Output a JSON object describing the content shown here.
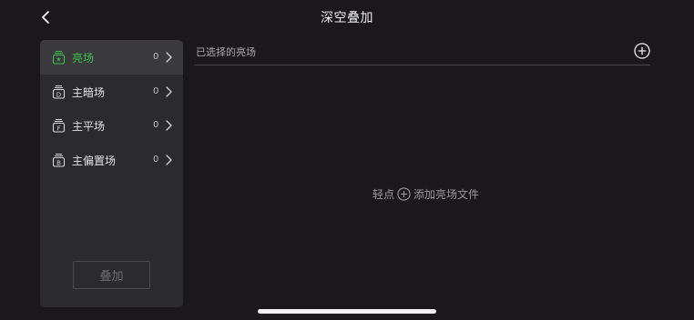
{
  "header": {
    "title": "深空叠加",
    "back_icon": "chevron-left-icon"
  },
  "sidebar": {
    "items": [
      {
        "label": "亮场",
        "count": "0",
        "icon": "light-frame-icon",
        "icon_letter": "",
        "active": true
      },
      {
        "label": "主暗场",
        "count": "0",
        "icon": "dark-frame-icon",
        "icon_letter": "D",
        "active": false
      },
      {
        "label": "主平场",
        "count": "0",
        "icon": "flat-frame-icon",
        "icon_letter": "F",
        "active": false
      },
      {
        "label": "主偏置场",
        "count": "0",
        "icon": "bias-frame-icon",
        "icon_letter": "B",
        "active": false
      }
    ],
    "stack_button": "叠加"
  },
  "main": {
    "selected_label": "已选择的亮场",
    "hint_prefix": "轻点",
    "hint_suffix": "添加亮场文件"
  },
  "colors": {
    "accent": "#3ec04b",
    "background": "#1a181b",
    "panel": "#2b2a2d",
    "active_item": "#3a393c"
  }
}
